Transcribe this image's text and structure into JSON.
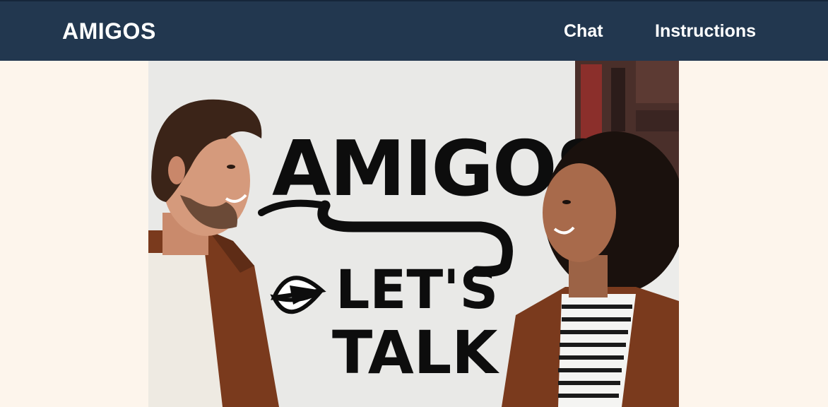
{
  "navbar": {
    "brand": "AMIGOS",
    "links": [
      "Chat",
      "Instructions"
    ]
  },
  "hero": {
    "sign_title": "AMIGOS",
    "sign_line1": "LET'S",
    "sign_line2": "TALK"
  },
  "colors": {
    "navbar_bg": "#22374f",
    "page_bg": "#fdf5ec",
    "nav_text": "#ffffff"
  }
}
